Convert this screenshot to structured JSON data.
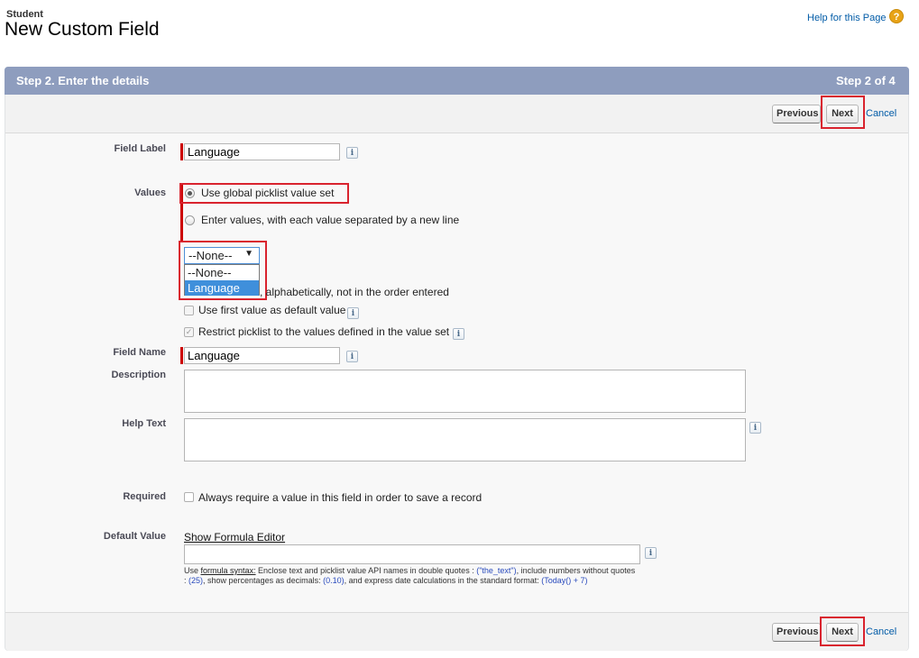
{
  "header": {
    "object_label": "Student",
    "page_title": "New Custom Field",
    "help_link": "Help for this Page",
    "help_icon": "?"
  },
  "step": {
    "title": "Step 2. Enter the details",
    "count": "Step 2 of 4"
  },
  "buttons": {
    "previous": "Previous",
    "next": "Next",
    "cancel": "Cancel"
  },
  "form": {
    "field_label": {
      "label": "Field Label",
      "value": "Language"
    },
    "values": {
      "label": "Values",
      "option_global": "Use global picklist value set",
      "option_enter": "Enter values, with each value separated by a new line",
      "dropdown_selected": "--None--",
      "dropdown_options": [
        "--None--",
        "Language"
      ],
      "highlighted_option": "Language",
      "sort_option_visible": ", alphabetically, not in the order entered",
      "default_first": "Use first value as default value",
      "restrict": "Restrict picklist to the values defined in the value set"
    },
    "field_name": {
      "label": "Field Name",
      "value": "Language"
    },
    "description": {
      "label": "Description",
      "value": ""
    },
    "help_text": {
      "label": "Help Text",
      "value": ""
    },
    "required": {
      "label": "Required",
      "checkbox_text": "Always require a value in this field in order to save a record"
    },
    "default_value": {
      "label": "Default Value",
      "formula_link": "Show Formula Editor",
      "value": "",
      "hint_prefix": "Use ",
      "hint_link": "formula syntax:",
      "hint_1": " Enclose text and picklist value API names in double quotes : ",
      "hint_code_1": "(\"the_text\")",
      "hint_2": ", include numbers without quotes : ",
      "hint_code_2": "(25)",
      "hint_3": ", show percentages as decimals: ",
      "hint_code_3": "(0.10)",
      "hint_4": ", and express date calculations in the standard format: ",
      "hint_code_4": "(Today() + 7)"
    }
  },
  "info_icon": "i",
  "colors": {
    "header_band": "#8e9dbe",
    "highlight": "#d9232e",
    "required": "#cc0000",
    "link": "#015ba7"
  }
}
